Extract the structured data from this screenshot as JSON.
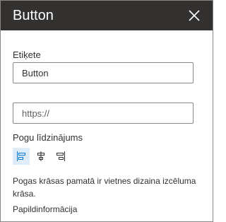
{
  "header": {
    "title": "Button",
    "close_icon": "close-icon"
  },
  "label_field": {
    "label": "Etiķete",
    "value": "Button"
  },
  "link_field": {
    "label": "",
    "placeholder": "https://"
  },
  "alignment": {
    "label": "Pogu līdzinājums",
    "options": [
      {
        "name": "align-left-icon",
        "selected": true
      },
      {
        "name": "align-center-icon",
        "selected": false
      },
      {
        "name": "align-right-icon",
        "selected": false
      }
    ]
  },
  "description": "Pogas krāsas pamatā ir vietnes dizaina izcēluma krāsa.",
  "more_info": "Papildinformācija",
  "colors": {
    "header_bg": "#323130",
    "accent": "#0078d4",
    "selected_bg": "#deecf9"
  }
}
